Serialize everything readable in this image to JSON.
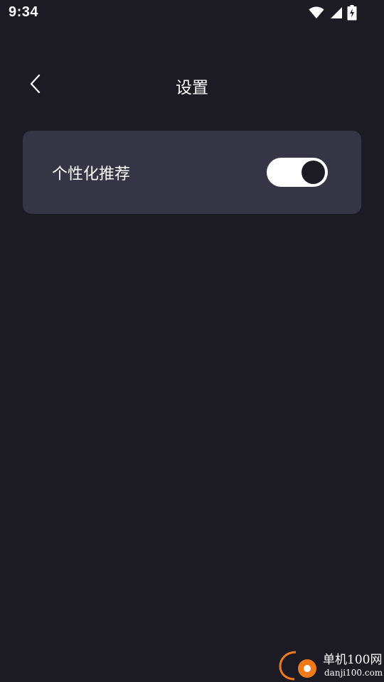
{
  "status_bar": {
    "time": "9:34",
    "icons": [
      "wifi-icon",
      "signal-icon",
      "battery-charging-icon"
    ]
  },
  "header": {
    "back_icon": "chevron-left-icon",
    "title": "设置"
  },
  "settings": [
    {
      "label": "个性化推荐",
      "enabled": true
    }
  ],
  "watermark": {
    "brand": "单机100网",
    "url": "danji100.com"
  },
  "colors": {
    "background": "#1c1b23",
    "card": "#363545",
    "toggle_on_track": "#ffffff",
    "toggle_knob": "#1c1b23",
    "watermark_orange": "#f07a1a"
  }
}
